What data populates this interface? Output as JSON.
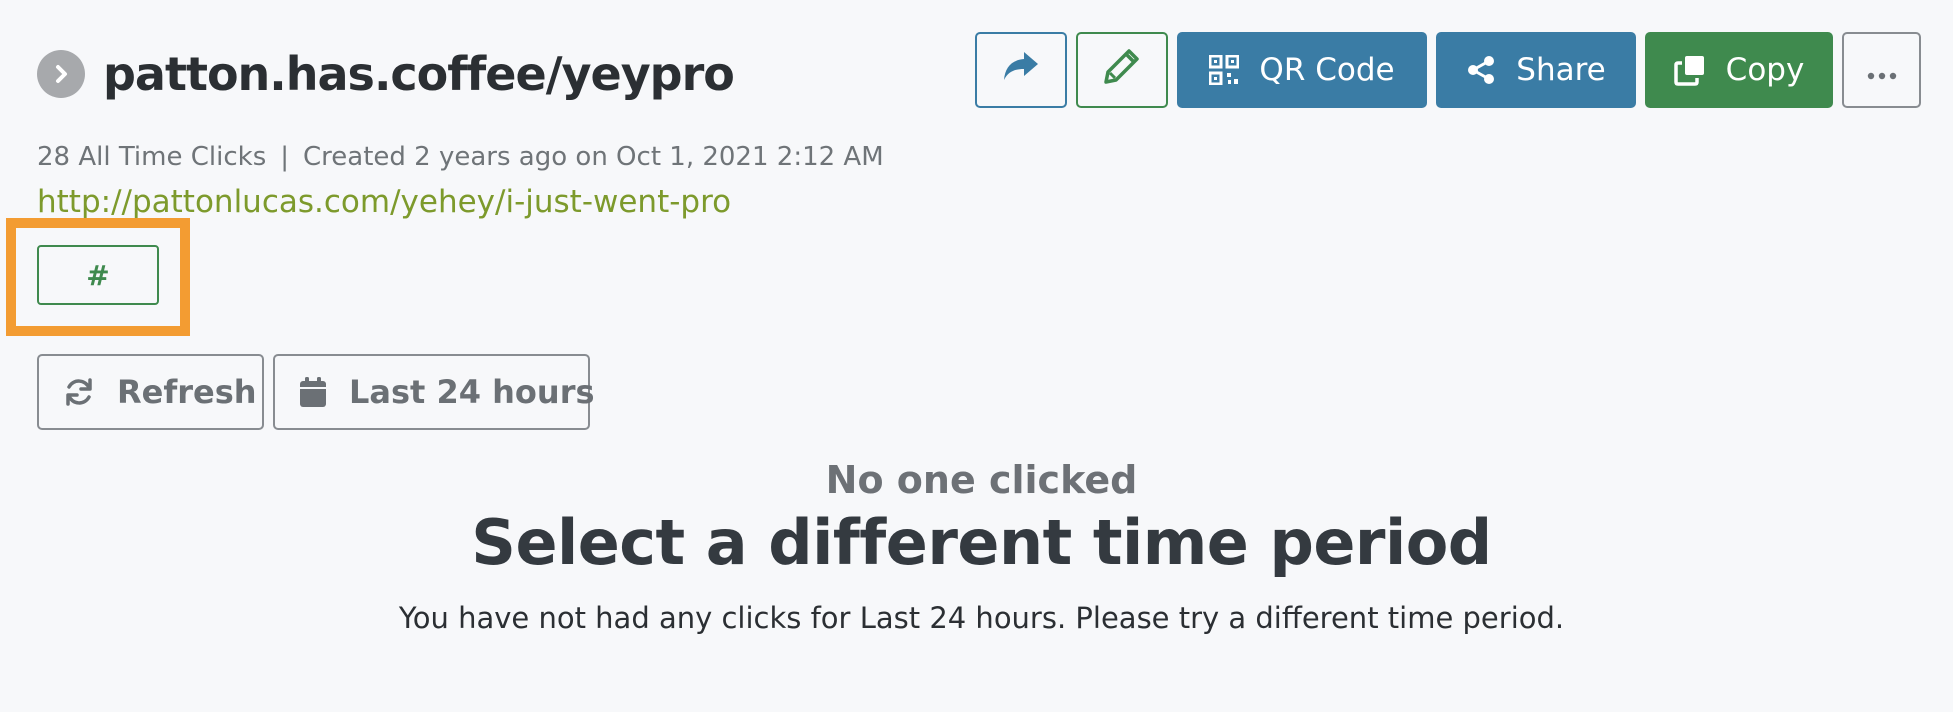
{
  "link": {
    "title": "patton.has.coffee/yeypro",
    "clicks_text": "28 All Time Clicks",
    "separator": "|",
    "created_text": "Created 2 years ago on Oct 1, 2021 2:12 AM",
    "destination": "http://pattonlucas.com/yehey/i-just-went-pro",
    "tag_label": "#"
  },
  "toolbar": {
    "qr_label": "QR Code",
    "share_label": "Share",
    "copy_label": "Copy"
  },
  "filters": {
    "refresh_label": "Refresh",
    "range_label": "Last 24 hours"
  },
  "empty_state": {
    "subtitle": "No one clicked",
    "title": "Select a different time period",
    "message": "You have not had any clicks for Last 24 hours. Please try a different time period."
  },
  "icons": {
    "expand": "chevron-right-icon",
    "redirect": "share-arrow-icon",
    "edit": "pencil-icon",
    "qr": "qr-code-icon",
    "share": "share-nodes-icon",
    "copy": "copy-icon",
    "more": "ellipsis-icon",
    "refresh": "refresh-icon",
    "calendar": "calendar-icon"
  },
  "colors": {
    "primary_blue": "#3a7ca5",
    "success_green": "#3f8a4e",
    "link_green": "#7d9a2c",
    "highlight_orange": "#f39c32",
    "background": "#f7f8fa"
  }
}
